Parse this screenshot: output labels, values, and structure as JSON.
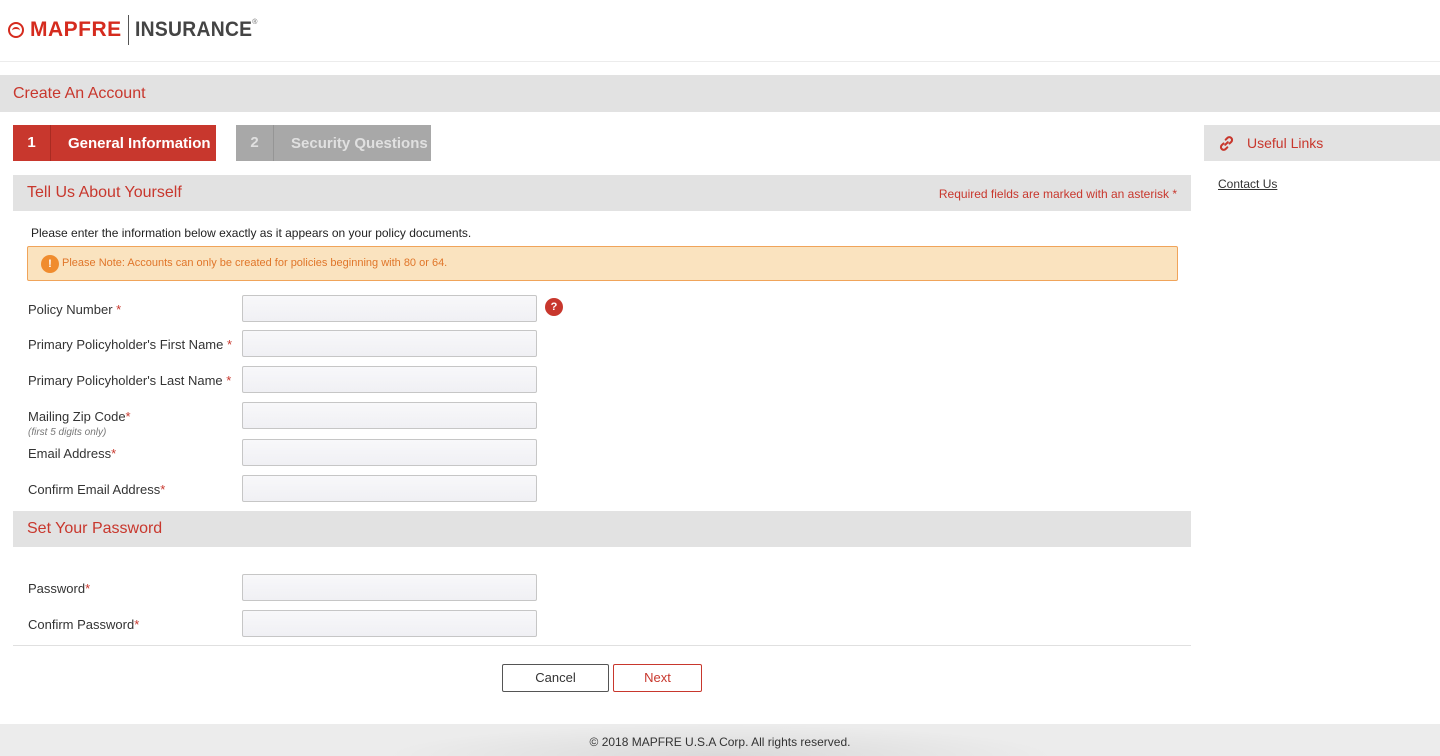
{
  "header": {
    "brand": "MAPFRE",
    "product": "INSURANCE",
    "registered": "®"
  },
  "page": {
    "title": "Create An Account"
  },
  "steps": [
    {
      "number": "1",
      "label": "General Information",
      "state": "active"
    },
    {
      "number": "2",
      "label": "Security Questions",
      "state": "inactive"
    }
  ],
  "about_section": {
    "heading": "Tell Us About Yourself",
    "required_note": "Required fields are marked with an asterisk *",
    "intro": "Please enter the information below exactly as it appears on your policy documents.",
    "notice_icon": "!",
    "notice": "Please Note: Accounts can only be created for policies beginning with 80 or 64.",
    "help_icon": "?",
    "fields": {
      "policy_number": {
        "label": "Policy Number",
        "asterisk": " *",
        "value": ""
      },
      "first_name": {
        "label": "Primary Policyholder's First Name",
        "asterisk": " *",
        "value": ""
      },
      "last_name": {
        "label": "Primary Policyholder's Last Name",
        "asterisk": " *",
        "value": ""
      },
      "zip": {
        "label": "Mailing Zip Code",
        "asterisk": "*",
        "hint": "(first 5 digits only)",
        "value": ""
      },
      "email": {
        "label": "Email Address",
        "asterisk": "*",
        "value": ""
      },
      "confirm_email": {
        "label": "Confirm Email Address",
        "asterisk": "*",
        "value": ""
      }
    }
  },
  "password_section": {
    "heading": "Set Your Password",
    "fields": {
      "password": {
        "label": "Password",
        "asterisk": "*",
        "value": ""
      },
      "confirm_password": {
        "label": "Confirm Password",
        "asterisk": "*",
        "value": ""
      }
    }
  },
  "actions": {
    "cancel": "Cancel",
    "next": "Next"
  },
  "sidebar": {
    "heading": "Useful Links",
    "icon": "link-icon",
    "links": [
      {
        "label": "Contact Us"
      }
    ]
  },
  "footer": {
    "copyright": "© 2018 MAPFRE U.S.A Corp. All rights reserved."
  },
  "colors": {
    "accent": "#c8372d",
    "inactive_step": "#a8a8a8",
    "notice_bg": "#fae3bf",
    "notice_border": "#f0a45a",
    "notice_text": "#e0762a"
  }
}
